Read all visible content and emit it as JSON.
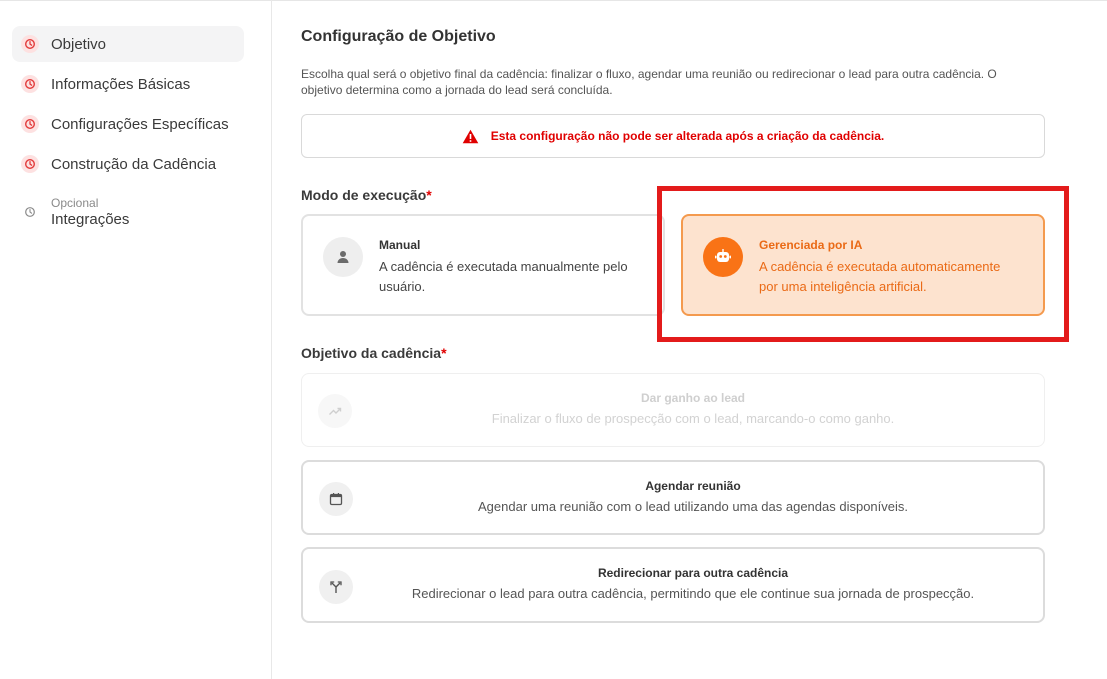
{
  "sidebar": {
    "items": [
      {
        "label": "Objetivo",
        "active": true,
        "icon": "clock-icon"
      },
      {
        "label": "Informações Básicas",
        "icon": "clock-icon"
      },
      {
        "label": "Configurações Específicas",
        "icon": "clock-icon"
      },
      {
        "label": "Construção da Cadência",
        "icon": "clock-icon"
      },
      {
        "label": "Integrações",
        "tag": "Opcional",
        "icon": "clock-icon"
      }
    ]
  },
  "main": {
    "title": "Configuração de Objetivo",
    "description": "Escolha qual será o objetivo final da cadência: finalizar o fluxo, agendar uma reunião ou redirecionar o lead para outra cadência. O objetivo determina como a jornada do lead será concluída.",
    "warning": "Esta configuração não pode ser alterada após a criação da cadência.",
    "execution_mode": {
      "label": "Modo de execução",
      "required_mark": "*",
      "options": [
        {
          "title": "Manual",
          "description": "A cadência é executada manualmente pelo usuário.",
          "icon": "user-icon",
          "selected": false
        },
        {
          "title": "Gerenciada por IA",
          "description": "A cadência é executada automaticamente por uma inteligência artificial.",
          "icon": "robot-icon",
          "selected": true
        }
      ]
    },
    "objective": {
      "label": "Objetivo da cadência",
      "required_mark": "*",
      "options": [
        {
          "title": "Dar ganho ao lead",
          "description": "Finalizar o fluxo de prospecção com o lead, marcando-o como ganho.",
          "icon": "trending-up-icon",
          "disabled": true
        },
        {
          "title": "Agendar reunião",
          "description": "Agendar uma reunião com o lead utilizando uma das agendas disponíveis.",
          "icon": "calendar-icon",
          "disabled": false
        },
        {
          "title": "Redirecionar para outra cadência",
          "description": "Redirecionar o lead para outra cadência, permitindo que ele continue sua jornada de prospecção.",
          "icon": "split-icon",
          "disabled": false
        }
      ]
    }
  },
  "colors": {
    "accent": "#f97316",
    "selected_bg": "#fde3cf",
    "warning": "#e00000",
    "highlight": "#e31b1b"
  }
}
